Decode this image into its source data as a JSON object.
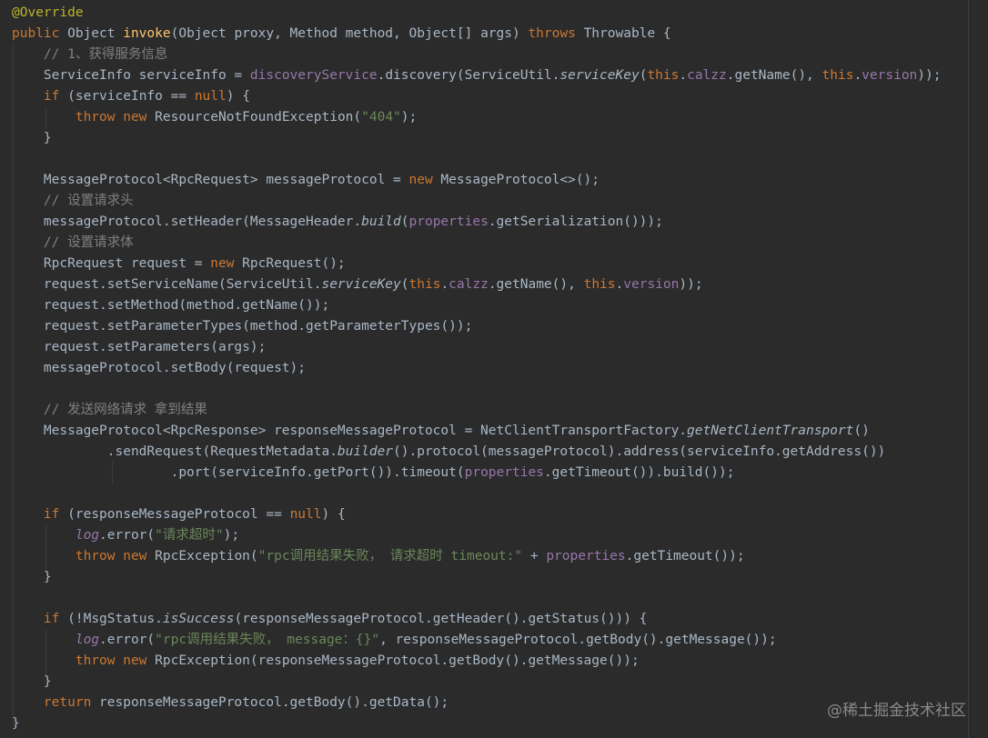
{
  "code_lines": [
    [
      [
        "a",
        "@Override"
      ]
    ],
    [
      [
        "k",
        "public "
      ],
      [
        "d",
        "Object "
      ],
      [
        "m",
        "invoke"
      ],
      [
        "d",
        "(Object proxy, Method method, Object[] args) "
      ],
      [
        "k",
        "throws "
      ],
      [
        "d",
        "Throwable {"
      ]
    ],
    [
      [
        "d",
        "    "
      ],
      [
        "c",
        "// 1、获得服务信息"
      ]
    ],
    [
      [
        "d",
        "    ServiceInfo serviceInfo = "
      ],
      [
        "f",
        "discoveryService"
      ],
      [
        "d",
        ".discovery(ServiceUtil."
      ],
      [
        "i",
        "serviceKey"
      ],
      [
        "d",
        "("
      ],
      [
        "k",
        "this"
      ],
      [
        "d",
        "."
      ],
      [
        "f",
        "calzz"
      ],
      [
        "d",
        ".getName(), "
      ],
      [
        "k",
        "this"
      ],
      [
        "d",
        "."
      ],
      [
        "f",
        "version"
      ],
      [
        "d",
        "));"
      ]
    ],
    [
      [
        "d",
        "    "
      ],
      [
        "k",
        "if "
      ],
      [
        "d",
        "(serviceInfo == "
      ],
      [
        "k",
        "null"
      ],
      [
        "d",
        ") {"
      ]
    ],
    [
      [
        "d",
        "        "
      ],
      [
        "k",
        "throw new "
      ],
      [
        "d",
        "ResourceNotFoundException("
      ],
      [
        "s",
        "\"404\""
      ],
      [
        "d",
        ");"
      ]
    ],
    [
      [
        "d",
        "    }"
      ]
    ],
    [],
    [
      [
        "d",
        "    MessageProtocol<RpcRequest> messageProtocol = "
      ],
      [
        "k",
        "new "
      ],
      [
        "d",
        "MessageProtocol<>();"
      ]
    ],
    [
      [
        "d",
        "    "
      ],
      [
        "c",
        "// 设置请求头"
      ]
    ],
    [
      [
        "d",
        "    messageProtocol.setHeader(MessageHeader."
      ],
      [
        "i",
        "build"
      ],
      [
        "d",
        "("
      ],
      [
        "f",
        "properties"
      ],
      [
        "d",
        ".getSerialization()));"
      ]
    ],
    [
      [
        "d",
        "    "
      ],
      [
        "c",
        "// 设置请求体"
      ]
    ],
    [
      [
        "d",
        "    RpcRequest request = "
      ],
      [
        "k",
        "new "
      ],
      [
        "d",
        "RpcRequest();"
      ]
    ],
    [
      [
        "d",
        "    request.setServiceName(ServiceUtil."
      ],
      [
        "i",
        "serviceKey"
      ],
      [
        "d",
        "("
      ],
      [
        "k",
        "this"
      ],
      [
        "d",
        "."
      ],
      [
        "f",
        "calzz"
      ],
      [
        "d",
        ".getName(), "
      ],
      [
        "k",
        "this"
      ],
      [
        "d",
        "."
      ],
      [
        "f",
        "version"
      ],
      [
        "d",
        "));"
      ]
    ],
    [
      [
        "d",
        "    request.setMethod(method.getName());"
      ]
    ],
    [
      [
        "d",
        "    request.setParameterTypes(method.getParameterTypes());"
      ]
    ],
    [
      [
        "d",
        "    request.setParameters(args);"
      ]
    ],
    [
      [
        "d",
        "    messageProtocol.setBody(request);"
      ]
    ],
    [],
    [
      [
        "d",
        "    "
      ],
      [
        "c",
        "// 发送网络请求 拿到结果"
      ]
    ],
    [
      [
        "d",
        "    MessageProtocol<RpcResponse> responseMessageProtocol = NetClientTransportFactory."
      ],
      [
        "i",
        "getNetClientTransport"
      ],
      [
        "d",
        "()"
      ]
    ],
    [
      [
        "d",
        "            .sendRequest(RequestMetadata."
      ],
      [
        "i",
        "builder"
      ],
      [
        "d",
        "().protocol(messageProtocol).address(serviceInfo.getAddress())"
      ]
    ],
    [
      [
        "d",
        "                    .port(serviceInfo.getPort()).timeout("
      ],
      [
        "f",
        "properties"
      ],
      [
        "d",
        ".getTimeout()).build());"
      ]
    ],
    [],
    [
      [
        "d",
        "    "
      ],
      [
        "k",
        "if "
      ],
      [
        "d",
        "(responseMessageProtocol == "
      ],
      [
        "k",
        "null"
      ],
      [
        "d",
        ") {"
      ]
    ],
    [
      [
        "d",
        "        "
      ],
      [
        "fi",
        "log"
      ],
      [
        "d",
        ".error("
      ],
      [
        "s",
        "\"请求超时\""
      ],
      [
        "d",
        ");"
      ]
    ],
    [
      [
        "d",
        "        "
      ],
      [
        "k",
        "throw new "
      ],
      [
        "d",
        "RpcException("
      ],
      [
        "s",
        "\"rpc调用结果失败， 请求超时 timeout:\""
      ],
      [
        "d",
        " + "
      ],
      [
        "f",
        "properties"
      ],
      [
        "d",
        ".getTimeout());"
      ]
    ],
    [
      [
        "d",
        "    }"
      ]
    ],
    [],
    [
      [
        "d",
        "    "
      ],
      [
        "k",
        "if "
      ],
      [
        "d",
        "(!MsgStatus."
      ],
      [
        "i",
        "isSuccess"
      ],
      [
        "d",
        "(responseMessageProtocol.getHeader().getStatus())) {"
      ]
    ],
    [
      [
        "d",
        "        "
      ],
      [
        "fi",
        "log"
      ],
      [
        "d",
        ".error("
      ],
      [
        "s",
        "\"rpc调用结果失败， message：{}\""
      ],
      [
        "d",
        ", responseMessageProtocol.getBody().getMessage());"
      ]
    ],
    [
      [
        "d",
        "        "
      ],
      [
        "k",
        "throw new "
      ],
      [
        "d",
        "RpcException(responseMessageProtocol.getBody().getMessage());"
      ]
    ],
    [
      [
        "d",
        "    }"
      ]
    ],
    [
      [
        "d",
        "    "
      ],
      [
        "k",
        "return "
      ],
      [
        "d",
        "responseMessageProtocol.getBody().getData();"
      ]
    ],
    [
      [
        "d",
        "}"
      ]
    ]
  ],
  "watermark": "@稀土掘金技术社区"
}
